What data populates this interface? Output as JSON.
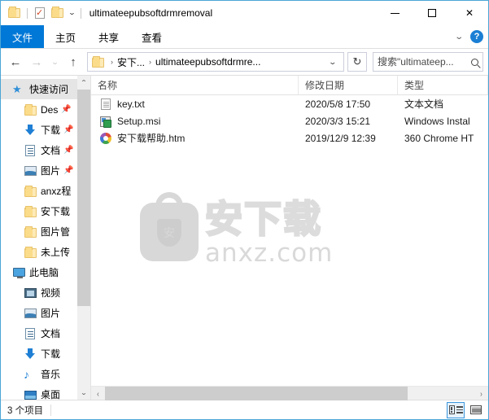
{
  "window": {
    "title": "ultimateepubsoftdrmremoval",
    "quick_access": [
      "folder-icon",
      "properties-icon",
      "new-folder-icon",
      "customize-chevron-icon"
    ],
    "controls": {
      "minimize": "minimize-icon",
      "maximize": "maximize-icon",
      "close": "close-icon"
    }
  },
  "ribbon": {
    "tabs": [
      {
        "label": "文件",
        "active": true
      },
      {
        "label": "主页",
        "active": false
      },
      {
        "label": "共享",
        "active": false
      },
      {
        "label": "查看",
        "active": false
      }
    ],
    "collapse_icon": "chevron-down-icon",
    "help_label": "?"
  },
  "address": {
    "back_icon": "←",
    "forward_icon": "→",
    "recent_icon": "⌄",
    "up_icon": "↑",
    "breadcrumb": [
      "安下...",
      "ultimateepubsoftdrmre..."
    ],
    "separator": "›",
    "dropdown_icon": "⌄",
    "refresh_icon": "↻",
    "search_placeholder": "搜索\"ultimateep..."
  },
  "sidebar": {
    "items": [
      {
        "label": "快速访问",
        "icon": "star-pin-icon",
        "indent": 0,
        "selected": true,
        "pinned": false
      },
      {
        "label": "Des",
        "icon": "folder-icon",
        "indent": 1,
        "selected": false,
        "pinned": true
      },
      {
        "label": "下载",
        "icon": "download-icon",
        "indent": 1,
        "selected": false,
        "pinned": true
      },
      {
        "label": "文档",
        "icon": "document-icon",
        "indent": 1,
        "selected": false,
        "pinned": true
      },
      {
        "label": "图片",
        "icon": "picture-icon",
        "indent": 1,
        "selected": false,
        "pinned": true
      },
      {
        "label": "anxz程",
        "icon": "folder-icon",
        "indent": 1,
        "selected": false,
        "pinned": false
      },
      {
        "label": "安下载",
        "icon": "folder-icon",
        "indent": 1,
        "selected": false,
        "pinned": false
      },
      {
        "label": "图片管",
        "icon": "folder-icon",
        "indent": 1,
        "selected": false,
        "pinned": false
      },
      {
        "label": "未上传",
        "icon": "folder-icon",
        "indent": 1,
        "selected": false,
        "pinned": false
      },
      {
        "label": "此电脑",
        "icon": "this-pc-icon",
        "indent": 0,
        "selected": false,
        "pinned": false
      },
      {
        "label": "视频",
        "icon": "video-icon",
        "indent": 1,
        "selected": false,
        "pinned": false
      },
      {
        "label": "图片",
        "icon": "picture-icon",
        "indent": 1,
        "selected": false,
        "pinned": false
      },
      {
        "label": "文档",
        "icon": "document-icon",
        "indent": 1,
        "selected": false,
        "pinned": false
      },
      {
        "label": "下载",
        "icon": "download-icon",
        "indent": 1,
        "selected": false,
        "pinned": false
      },
      {
        "label": "音乐",
        "icon": "music-icon",
        "indent": 1,
        "selected": false,
        "pinned": false
      },
      {
        "label": "桌面",
        "icon": "desktop-icon",
        "indent": 1,
        "selected": false,
        "pinned": false
      }
    ],
    "pin_glyph": "📌",
    "scroll_up_icon": "⌃",
    "scroll_down_icon": "⌄"
  },
  "filelist": {
    "columns": [
      {
        "key": "name",
        "label": "名称",
        "sorted": "asc"
      },
      {
        "key": "date",
        "label": "修改日期",
        "sorted": ""
      },
      {
        "key": "type",
        "label": "类型",
        "sorted": ""
      }
    ],
    "sort_caret": "⌃",
    "rows": [
      {
        "name": "key.txt",
        "date": "2020/5/8 17:50",
        "type": "文本文档",
        "icon": "text-file-icon"
      },
      {
        "name": "Setup.msi",
        "date": "2020/3/3 15:21",
        "type": "Windows Instal",
        "icon": "msi-installer-icon"
      },
      {
        "name": "安下载帮助.htm",
        "date": "2019/12/9 12:39",
        "type": "360 Chrome HT",
        "icon": "html-file-icon"
      }
    ]
  },
  "watermark": {
    "cn_text": "安下载",
    "en_text": "anxz.com",
    "shield_char": "安"
  },
  "scrollbars": {
    "h_left_icon": "‹",
    "h_right_icon": "›"
  },
  "status": {
    "item_count": "3 个项目",
    "view_details_icon": "details-view-icon",
    "view_large_icon": "large-icons-view-icon"
  },
  "colors": {
    "accent": "#0078d7",
    "window_border": "#4aa5d6",
    "folder_yellow": "#fbdc8a",
    "selection": "#e5e5e5"
  }
}
